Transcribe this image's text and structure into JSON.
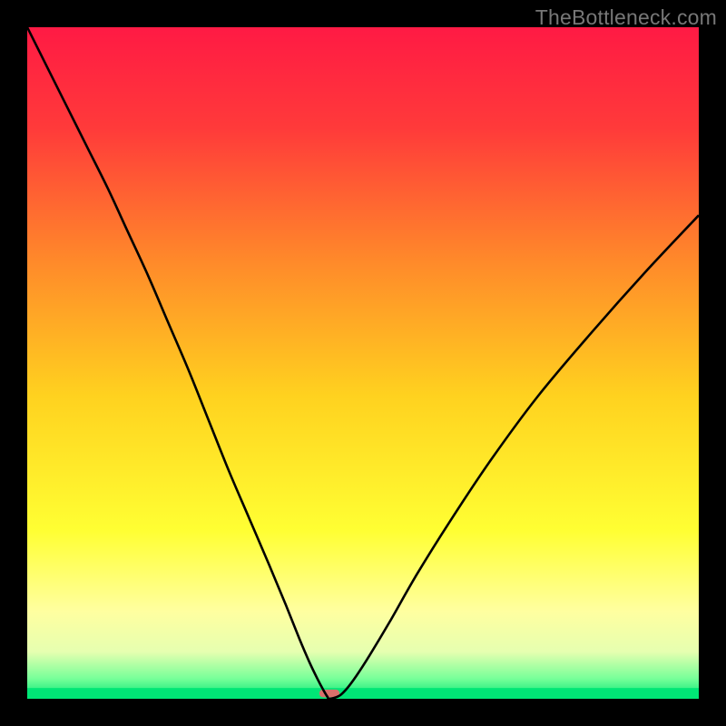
{
  "watermark": "TheBottleneck.com",
  "chart_data": {
    "type": "line",
    "title": "",
    "xlabel": "",
    "ylabel": "",
    "xlim": [
      0,
      100
    ],
    "ylim": [
      0,
      100
    ],
    "grid": false,
    "legend": false,
    "background_gradient_stops": [
      {
        "offset": 0.0,
        "color": "#ff1a44"
      },
      {
        "offset": 0.15,
        "color": "#ff3a3a"
      },
      {
        "offset": 0.35,
        "color": "#ff8a2a"
      },
      {
        "offset": 0.55,
        "color": "#ffd21f"
      },
      {
        "offset": 0.75,
        "color": "#ffff33"
      },
      {
        "offset": 0.87,
        "color": "#ffffa0"
      },
      {
        "offset": 0.93,
        "color": "#e6ffb0"
      },
      {
        "offset": 0.97,
        "color": "#77ff99"
      },
      {
        "offset": 1.0,
        "color": "#00e676"
      }
    ],
    "series": [
      {
        "name": "bottleneck-curve",
        "color": "#000000",
        "x": [
          0.0,
          3.0,
          6.0,
          9.0,
          12.0,
          15.0,
          18.0,
          21.0,
          24.0,
          27.0,
          30.0,
          33.0,
          36.0,
          38.5,
          40.5,
          42.0,
          43.2,
          44.1,
          44.7,
          45.0,
          46.4,
          47.5,
          49.0,
          51.0,
          54.0,
          58.0,
          63.0,
          69.0,
          76.0,
          84.0,
          92.0,
          100.0
        ],
        "y": [
          100.0,
          94.0,
          88.0,
          82.0,
          76.0,
          69.5,
          63.0,
          56.0,
          49.0,
          41.5,
          34.0,
          27.0,
          20.0,
          14.0,
          9.0,
          5.5,
          3.0,
          1.3,
          0.3,
          0.0,
          0.4,
          1.4,
          3.4,
          6.5,
          11.5,
          18.5,
          26.5,
          35.5,
          45.0,
          54.5,
          63.5,
          72.0
        ]
      }
    ],
    "marker": {
      "name": "optimal-marker",
      "x": 45.0,
      "width_pct": 3.0,
      "color": "#d9706b"
    },
    "floor": {
      "color": "#00e676",
      "height_pct": 1.6
    }
  }
}
